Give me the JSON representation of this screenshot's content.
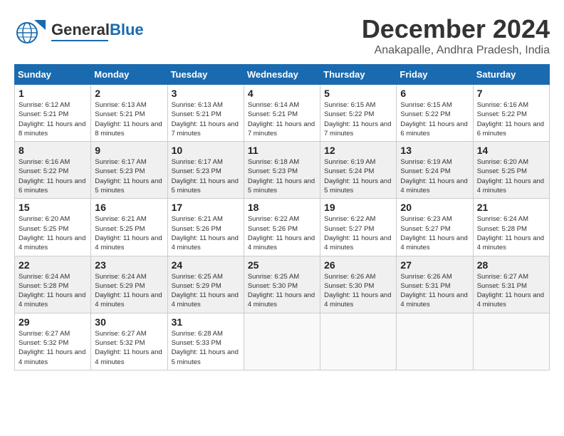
{
  "header": {
    "logo_general": "General",
    "logo_blue": "Blue",
    "month_title": "December 2024",
    "location": "Anakapalle, Andhra Pradesh, India"
  },
  "weekdays": [
    "Sunday",
    "Monday",
    "Tuesday",
    "Wednesday",
    "Thursday",
    "Friday",
    "Saturday"
  ],
  "weeks": [
    [
      {
        "day": "1",
        "sunrise": "6:12 AM",
        "sunset": "5:21 PM",
        "daylight": "11 hours and 8 minutes."
      },
      {
        "day": "2",
        "sunrise": "6:13 AM",
        "sunset": "5:21 PM",
        "daylight": "11 hours and 8 minutes."
      },
      {
        "day": "3",
        "sunrise": "6:13 AM",
        "sunset": "5:21 PM",
        "daylight": "11 hours and 7 minutes."
      },
      {
        "day": "4",
        "sunrise": "6:14 AM",
        "sunset": "5:21 PM",
        "daylight": "11 hours and 7 minutes."
      },
      {
        "day": "5",
        "sunrise": "6:15 AM",
        "sunset": "5:22 PM",
        "daylight": "11 hours and 7 minutes."
      },
      {
        "day": "6",
        "sunrise": "6:15 AM",
        "sunset": "5:22 PM",
        "daylight": "11 hours and 6 minutes."
      },
      {
        "day": "7",
        "sunrise": "6:16 AM",
        "sunset": "5:22 PM",
        "daylight": "11 hours and 6 minutes."
      }
    ],
    [
      {
        "day": "8",
        "sunrise": "6:16 AM",
        "sunset": "5:22 PM",
        "daylight": "11 hours and 6 minutes."
      },
      {
        "day": "9",
        "sunrise": "6:17 AM",
        "sunset": "5:23 PM",
        "daylight": "11 hours and 5 minutes."
      },
      {
        "day": "10",
        "sunrise": "6:17 AM",
        "sunset": "5:23 PM",
        "daylight": "11 hours and 5 minutes."
      },
      {
        "day": "11",
        "sunrise": "6:18 AM",
        "sunset": "5:23 PM",
        "daylight": "11 hours and 5 minutes."
      },
      {
        "day": "12",
        "sunrise": "6:19 AM",
        "sunset": "5:24 PM",
        "daylight": "11 hours and 5 minutes."
      },
      {
        "day": "13",
        "sunrise": "6:19 AM",
        "sunset": "5:24 PM",
        "daylight": "11 hours and 4 minutes."
      },
      {
        "day": "14",
        "sunrise": "6:20 AM",
        "sunset": "5:25 PM",
        "daylight": "11 hours and 4 minutes."
      }
    ],
    [
      {
        "day": "15",
        "sunrise": "6:20 AM",
        "sunset": "5:25 PM",
        "daylight": "11 hours and 4 minutes."
      },
      {
        "day": "16",
        "sunrise": "6:21 AM",
        "sunset": "5:25 PM",
        "daylight": "11 hours and 4 minutes."
      },
      {
        "day": "17",
        "sunrise": "6:21 AM",
        "sunset": "5:26 PM",
        "daylight": "11 hours and 4 minutes."
      },
      {
        "day": "18",
        "sunrise": "6:22 AM",
        "sunset": "5:26 PM",
        "daylight": "11 hours and 4 minutes."
      },
      {
        "day": "19",
        "sunrise": "6:22 AM",
        "sunset": "5:27 PM",
        "daylight": "11 hours and 4 minutes."
      },
      {
        "day": "20",
        "sunrise": "6:23 AM",
        "sunset": "5:27 PM",
        "daylight": "11 hours and 4 minutes."
      },
      {
        "day": "21",
        "sunrise": "6:24 AM",
        "sunset": "5:28 PM",
        "daylight": "11 hours and 4 minutes."
      }
    ],
    [
      {
        "day": "22",
        "sunrise": "6:24 AM",
        "sunset": "5:28 PM",
        "daylight": "11 hours and 4 minutes."
      },
      {
        "day": "23",
        "sunrise": "6:24 AM",
        "sunset": "5:29 PM",
        "daylight": "11 hours and 4 minutes."
      },
      {
        "day": "24",
        "sunrise": "6:25 AM",
        "sunset": "5:29 PM",
        "daylight": "11 hours and 4 minutes."
      },
      {
        "day": "25",
        "sunrise": "6:25 AM",
        "sunset": "5:30 PM",
        "daylight": "11 hours and 4 minutes."
      },
      {
        "day": "26",
        "sunrise": "6:26 AM",
        "sunset": "5:30 PM",
        "daylight": "11 hours and 4 minutes."
      },
      {
        "day": "27",
        "sunrise": "6:26 AM",
        "sunset": "5:31 PM",
        "daylight": "11 hours and 4 minutes."
      },
      {
        "day": "28",
        "sunrise": "6:27 AM",
        "sunset": "5:31 PM",
        "daylight": "11 hours and 4 minutes."
      }
    ],
    [
      {
        "day": "29",
        "sunrise": "6:27 AM",
        "sunset": "5:32 PM",
        "daylight": "11 hours and 4 minutes."
      },
      {
        "day": "30",
        "sunrise": "6:27 AM",
        "sunset": "5:32 PM",
        "daylight": "11 hours and 4 minutes."
      },
      {
        "day": "31",
        "sunrise": "6:28 AM",
        "sunset": "5:33 PM",
        "daylight": "11 hours and 5 minutes."
      },
      null,
      null,
      null,
      null
    ]
  ],
  "labels": {
    "sunrise": "Sunrise:",
    "sunset": "Sunset:",
    "daylight": "Daylight hours"
  }
}
